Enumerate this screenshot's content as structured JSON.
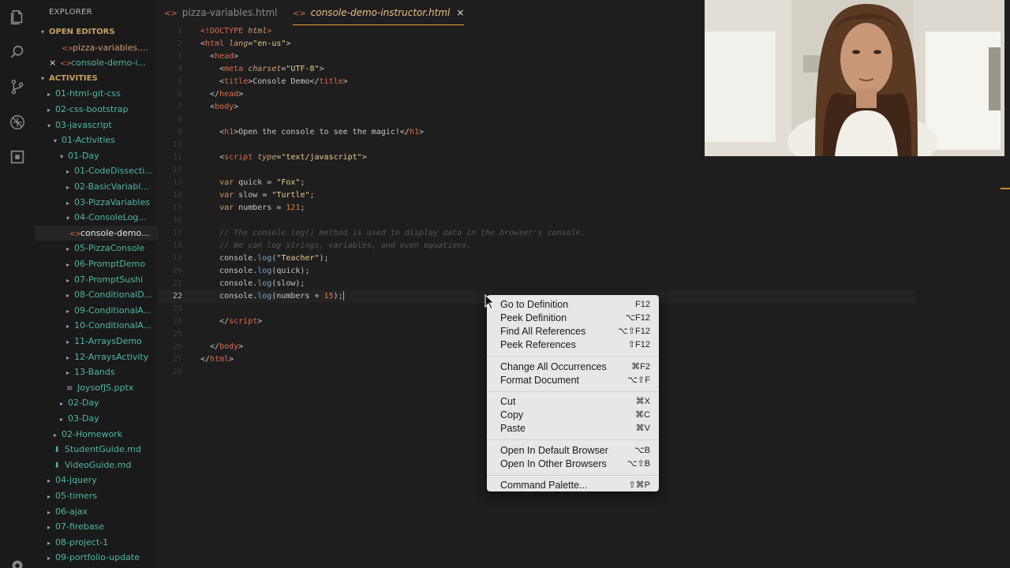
{
  "sidebar": {
    "header": "EXPLORER",
    "rows": [
      {
        "text": "OPEN EDITORS",
        "kind": "section",
        "indent": 0,
        "twisty": "▾",
        "icon": ""
      },
      {
        "text": "pizza-variables....",
        "kind": "orange",
        "indent": 1,
        "twisty": "",
        "icon": "<>"
      },
      {
        "text": "console-demo-i...",
        "kind": "teal",
        "indent": 1,
        "twisty": "",
        "icon": "<>",
        "close": "×"
      },
      {
        "text": "ACTIVITIES",
        "kind": "section",
        "indent": 0,
        "twisty": "▾",
        "icon": ""
      },
      {
        "text": "01-html-git-css",
        "kind": "teal",
        "indent": 1,
        "twisty": "▸",
        "icon": ""
      },
      {
        "text": "02-css-bootstrap",
        "kind": "teal",
        "indent": 1,
        "twisty": "▸",
        "icon": ""
      },
      {
        "text": "03-javascript",
        "kind": "teal",
        "indent": 1,
        "twisty": "▾",
        "icon": ""
      },
      {
        "text": "01-Activities",
        "kind": "teal",
        "indent": 2,
        "twisty": "▾",
        "icon": ""
      },
      {
        "text": "01-Day",
        "kind": "teal",
        "indent": 3,
        "twisty": "▾",
        "icon": ""
      },
      {
        "text": "01-CodeDissecti...",
        "kind": "teal",
        "indent": 4,
        "twisty": "▸",
        "icon": ""
      },
      {
        "text": "02-BasicVariabl...",
        "kind": "teal",
        "indent": 4,
        "twisty": "▸",
        "icon": ""
      },
      {
        "text": "03-PizzaVariables",
        "kind": "teal",
        "indent": 4,
        "twisty": "▸",
        "icon": ""
      },
      {
        "text": "04-ConsoleLog...",
        "kind": "teal",
        "indent": 4,
        "twisty": "▾",
        "icon": ""
      },
      {
        "text": "console-demo...",
        "kind": "teal-white",
        "indent": 5,
        "twisty": "",
        "icon": "<>",
        "selected": true
      },
      {
        "text": "05-PizzaConsole",
        "kind": "teal",
        "indent": 4,
        "twisty": "▸",
        "icon": ""
      },
      {
        "text": "06-PromptDemo",
        "kind": "teal",
        "indent": 4,
        "twisty": "▸",
        "icon": ""
      },
      {
        "text": "07-PromptSushi",
        "kind": "teal",
        "indent": 4,
        "twisty": "▸",
        "icon": ""
      },
      {
        "text": "08-ConditionalD...",
        "kind": "teal",
        "indent": 4,
        "twisty": "▸",
        "icon": ""
      },
      {
        "text": "09-ConditionalA...",
        "kind": "teal",
        "indent": 4,
        "twisty": "▸",
        "icon": ""
      },
      {
        "text": "10-ConditionalA...",
        "kind": "teal",
        "indent": 4,
        "twisty": "▸",
        "icon": ""
      },
      {
        "text": "11-ArraysDemo",
        "kind": "teal",
        "indent": 4,
        "twisty": "▸",
        "icon": ""
      },
      {
        "text": "12-ArraysActivity",
        "kind": "teal",
        "indent": 4,
        "twisty": "▸",
        "icon": ""
      },
      {
        "text": "13-Bands",
        "kind": "teal",
        "indent": 4,
        "twisty": "▸",
        "icon": ""
      },
      {
        "text": "JoysofJS.pptx",
        "kind": "teal",
        "indent": 4,
        "twisty": "",
        "icon": "≡"
      },
      {
        "text": "02-Day",
        "kind": "teal",
        "indent": 3,
        "twisty": "▸",
        "icon": ""
      },
      {
        "text": "03-Day",
        "kind": "teal",
        "indent": 3,
        "twisty": "▸",
        "icon": ""
      },
      {
        "text": "02-Homework",
        "kind": "teal",
        "indent": 2,
        "twisty": "▸",
        "icon": ""
      },
      {
        "text": "StudentGuide.md",
        "kind": "teal",
        "indent": 2,
        "twisty": "",
        "icon": "md"
      },
      {
        "text": "VideoGuide.md",
        "kind": "teal",
        "indent": 2,
        "twisty": "",
        "icon": "md"
      },
      {
        "text": "04-jquery",
        "kind": "teal",
        "indent": 1,
        "twisty": "▸",
        "icon": ""
      },
      {
        "text": "05-timers",
        "kind": "teal",
        "indent": 1,
        "twisty": "▸",
        "icon": ""
      },
      {
        "text": "06-ajax",
        "kind": "teal",
        "indent": 1,
        "twisty": "▸",
        "icon": ""
      },
      {
        "text": "07-firebase",
        "kind": "teal",
        "indent": 1,
        "twisty": "▸",
        "icon": ""
      },
      {
        "text": "08-project-1",
        "kind": "teal",
        "indent": 1,
        "twisty": "▸",
        "icon": ""
      },
      {
        "text": "09-portfolio-update",
        "kind": "teal",
        "indent": 1,
        "twisty": "▸",
        "icon": ""
      }
    ]
  },
  "tabs": [
    {
      "label": "pizza-variables.html",
      "active": false
    },
    {
      "label": "console-demo-instructor.html",
      "active": true,
      "close": "×"
    }
  ],
  "editor": {
    "current_line": 22,
    "lines": [
      [
        {
          "t": "<!DOCTYPE ",
          "c": "tag"
        },
        {
          "t": "html",
          "c": "attr"
        },
        {
          "t": ">",
          "c": "tag"
        }
      ],
      [
        {
          "t": "<",
          "c": "br"
        },
        {
          "t": "html",
          "c": "tag"
        },
        {
          "t": " lang",
          "c": "attr"
        },
        {
          "t": "=",
          "c": "br"
        },
        {
          "t": "\"en-us\"",
          "c": "str"
        },
        {
          "t": ">",
          "c": "br"
        }
      ],
      [
        {
          "t": "  <",
          "c": "br"
        },
        {
          "t": "head",
          "c": "tag"
        },
        {
          "t": ">",
          "c": "br"
        }
      ],
      [
        {
          "t": "    <",
          "c": "br"
        },
        {
          "t": "meta",
          "c": "tag"
        },
        {
          "t": " charset",
          "c": "attr"
        },
        {
          "t": "=",
          "c": "br"
        },
        {
          "t": "\"UTF-8\"",
          "c": "str"
        },
        {
          "t": ">",
          "c": "br"
        }
      ],
      [
        {
          "t": "    <",
          "c": "br"
        },
        {
          "t": "title",
          "c": "tag"
        },
        {
          "t": ">Console Demo</",
          "c": "br"
        },
        {
          "t": "title",
          "c": "tag"
        },
        {
          "t": ">",
          "c": "br"
        }
      ],
      [
        {
          "t": "  </",
          "c": "br"
        },
        {
          "t": "head",
          "c": "tag"
        },
        {
          "t": ">",
          "c": "br"
        }
      ],
      [
        {
          "t": "  <",
          "c": "br"
        },
        {
          "t": "body",
          "c": "tag"
        },
        {
          "t": ">",
          "c": "br"
        }
      ],
      [],
      [
        {
          "t": "    <",
          "c": "br"
        },
        {
          "t": "h1",
          "c": "tag"
        },
        {
          "t": ">Open the console to see the magic!</",
          "c": "br"
        },
        {
          "t": "h1",
          "c": "tag"
        },
        {
          "t": ">",
          "c": "br"
        }
      ],
      [],
      [
        {
          "t": "    <",
          "c": "br"
        },
        {
          "t": "script",
          "c": "tag"
        },
        {
          "t": " type",
          "c": "attr"
        },
        {
          "t": "=",
          "c": "br"
        },
        {
          "t": "\"text/javascript\"",
          "c": "str"
        },
        {
          "t": ">",
          "c": "br"
        }
      ],
      [],
      [
        {
          "t": "    var",
          "c": "kw"
        },
        {
          "t": " quick = ",
          "c": "br"
        },
        {
          "t": "\"Fox\"",
          "c": "str"
        },
        {
          "t": ";",
          "c": "br"
        }
      ],
      [
        {
          "t": "    var",
          "c": "kw"
        },
        {
          "t": " slow = ",
          "c": "br"
        },
        {
          "t": "\"Turtle\"",
          "c": "str"
        },
        {
          "t": ";",
          "c": "br"
        }
      ],
      [
        {
          "t": "    var",
          "c": "kw"
        },
        {
          "t": " numbers = ",
          "c": "br"
        },
        {
          "t": "121",
          "c": "num"
        },
        {
          "t": ";",
          "c": "br"
        }
      ],
      [],
      [
        {
          "t": "    // The console.log() method is used to display data in the browser's console.",
          "c": "com"
        }
      ],
      [
        {
          "t": "    // We can log strings, variables, and even equations.",
          "c": "com"
        }
      ],
      [
        {
          "t": "    console.",
          "c": "br"
        },
        {
          "t": "log",
          "c": "fn"
        },
        {
          "t": "(",
          "c": "br"
        },
        {
          "t": "\"Teacher\"",
          "c": "str"
        },
        {
          "t": ");",
          "c": "br"
        }
      ],
      [
        {
          "t": "    console.",
          "c": "br"
        },
        {
          "t": "log",
          "c": "fn"
        },
        {
          "t": "(quick);",
          "c": "br"
        }
      ],
      [
        {
          "t": "    console.",
          "c": "br"
        },
        {
          "t": "log",
          "c": "fn"
        },
        {
          "t": "(slow);",
          "c": "br"
        }
      ],
      [
        {
          "t": "    console.",
          "c": "br"
        },
        {
          "t": "log",
          "c": "fn"
        },
        {
          "t": "(numbers + ",
          "c": "br"
        },
        {
          "t": "15",
          "c": "num"
        },
        {
          "t": ");",
          "c": "br"
        },
        {
          "t": "",
          "c": "cursor"
        }
      ],
      [],
      [
        {
          "t": "    </",
          "c": "br"
        },
        {
          "t": "script",
          "c": "tag"
        },
        {
          "t": ">",
          "c": "br"
        }
      ],
      [],
      [
        {
          "t": "  </",
          "c": "br"
        },
        {
          "t": "body",
          "c": "tag"
        },
        {
          "t": ">",
          "c": "br"
        }
      ],
      [
        {
          "t": "</",
          "c": "br"
        },
        {
          "t": "html",
          "c": "tag"
        },
        {
          "t": ">",
          "c": "br"
        }
      ],
      []
    ]
  },
  "context_menu": {
    "groups": [
      [
        {
          "label": "Go to Definition",
          "shortcut": "F12"
        },
        {
          "label": "Peek Definition",
          "shortcut": "⌥F12"
        },
        {
          "label": "Find All References",
          "shortcut": "⌥⇧F12"
        },
        {
          "label": "Peek References",
          "shortcut": "⇧F12"
        }
      ],
      [
        {
          "label": "Change All Occurrences",
          "shortcut": "⌘F2"
        },
        {
          "label": "Format Document",
          "shortcut": "⌥⇧F"
        }
      ],
      [
        {
          "label": "Cut",
          "shortcut": "⌘X"
        },
        {
          "label": "Copy",
          "shortcut": "⌘C"
        },
        {
          "label": "Paste",
          "shortcut": "⌘V"
        }
      ],
      [
        {
          "label": "Open In Default Browser",
          "shortcut": "⌥B"
        },
        {
          "label": "Open In Other Browsers",
          "shortcut": "⌥⇧B"
        }
      ],
      [
        {
          "label": "Command Palette...",
          "shortcut": "⇧⌘P"
        }
      ]
    ]
  },
  "activity_bar": {
    "icons": [
      "files-icon",
      "search-icon",
      "source-control-icon",
      "debug-icon",
      "extensions-icon",
      "settings-gear-icon"
    ]
  },
  "colors": {
    "background": "#1e1e1e",
    "sidebar": "#1a1a1a",
    "accent": "#e8a030",
    "folder_text": "#4fb6a6",
    "html_icon": "#e06c4c"
  }
}
